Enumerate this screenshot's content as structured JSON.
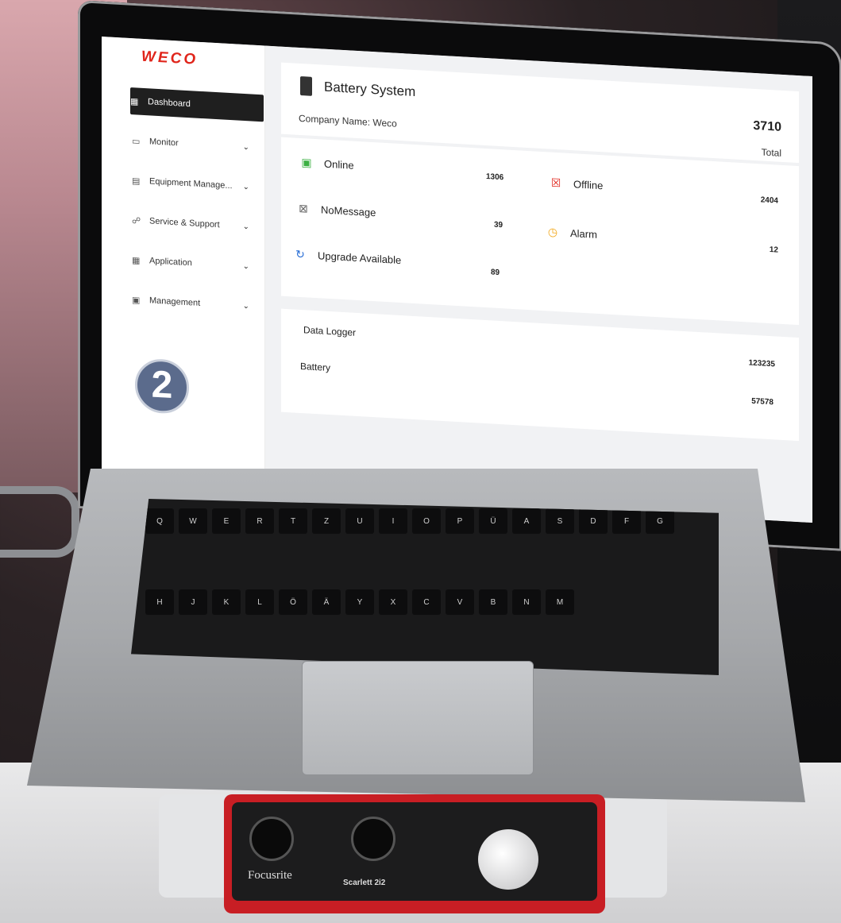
{
  "app": {
    "logo": "WECO"
  },
  "sidebar": {
    "items": [
      {
        "label": "Dashboard",
        "icon": "dashboard-icon",
        "active": true
      },
      {
        "label": "Monitor",
        "icon": "monitor-icon"
      },
      {
        "label": "Equipment Manage...",
        "icon": "equipment-icon"
      },
      {
        "label": "Service & Support",
        "icon": "support-icon"
      },
      {
        "label": "Application",
        "icon": "application-icon"
      },
      {
        "label": "Management",
        "icon": "management-icon"
      }
    ],
    "step_badge": "2"
  },
  "battery_system": {
    "title": "Battery System",
    "company": "Company Name: Weco",
    "total_value": "3710",
    "total_label": "Total"
  },
  "stats": [
    {
      "label": "Online",
      "value": "1306",
      "icon": "online-icon",
      "color": "#3cb043"
    },
    {
      "label": "Offline",
      "value": "2404",
      "icon": "offline-icon",
      "color": "#e0251b"
    },
    {
      "label": "NoMessage",
      "value": "39",
      "icon": "nomessage-icon",
      "color": "#666666"
    },
    {
      "label": "Alarm",
      "value": "12",
      "icon": "alarm-icon",
      "color": "#f2a81b"
    },
    {
      "label": "Upgrade Available",
      "value": "89",
      "icon": "upgrade-icon",
      "color": "#2a6fd6"
    }
  ],
  "summary": {
    "data_logger_label": "Data Logger",
    "data_logger_value": "123235",
    "battery_label": "Battery",
    "battery_value": "57578"
  },
  "keyboard": {
    "row1": [
      "Q",
      "W",
      "E",
      "R",
      "T",
      "Z",
      "U",
      "I",
      "O",
      "P",
      "Ü"
    ],
    "row2": [
      "A",
      "S",
      "D",
      "F",
      "G",
      "H",
      "J",
      "K",
      "L",
      "Ö",
      "Ä"
    ],
    "row3": [
      "Y",
      "X",
      "C",
      "V",
      "B",
      "N",
      "M"
    ]
  },
  "interface": {
    "brand": "Focusrite",
    "model": "Scarlett 2i2"
  }
}
